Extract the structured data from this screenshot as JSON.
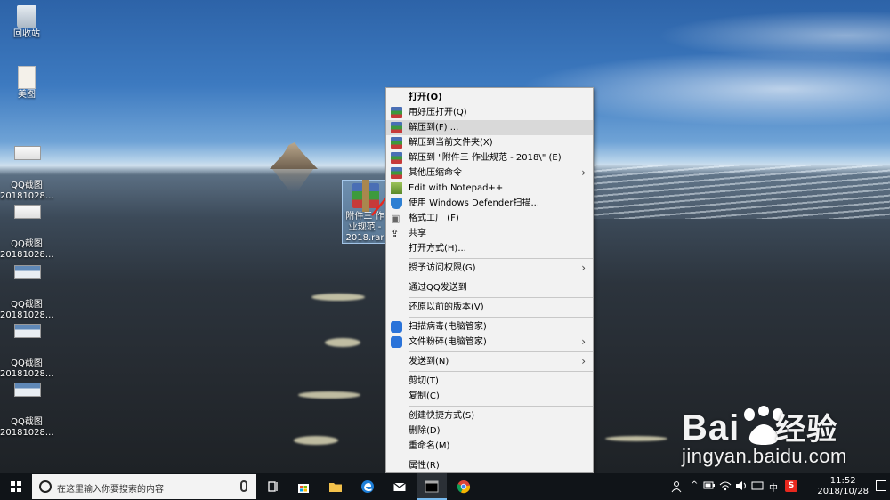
{
  "desktop": {
    "icons": [
      {
        "label": "回收站"
      },
      {
        "label": "美图"
      },
      {
        "label": "QQ截图\n20181028..."
      },
      {
        "label": "QQ截图\n20181028..."
      },
      {
        "label": "QQ截图\n20181028..."
      },
      {
        "label": "QQ截图\n20181028..."
      },
      {
        "label": "QQ截图\n20181028..."
      }
    ],
    "selected_file_label": "附件三 作业规范 - 2018.rar"
  },
  "context_menu": {
    "items": [
      {
        "label": "打开(O)",
        "bold": true
      },
      {
        "label": "用好压打开(Q)",
        "icon": "winrar-icon"
      },
      {
        "label": "解压到(F) ...",
        "icon": "winrar-icon",
        "hover": true
      },
      {
        "label": "解压到当前文件夹(X)",
        "icon": "winrar-icon"
      },
      {
        "label": "解压到 \"附件三  作业规范 - 2018\\\" (E)",
        "icon": "winrar-icon"
      },
      {
        "label": "其他压缩命令",
        "icon": "winrar-icon",
        "submenu": true
      },
      {
        "label": "Edit with Notepad++",
        "icon": "notepad-icon"
      },
      {
        "label": "使用 Windows Defender扫描...",
        "icon": "defender-shield-icon"
      },
      {
        "label": "格式工厂 (F)",
        "icon": "format-factory-icon"
      },
      {
        "label": "共享",
        "icon": "share-icon"
      },
      {
        "label": "打开方式(H)..."
      },
      {
        "label": "授予访问权限(G)",
        "submenu": true,
        "sep_before": true
      },
      {
        "label": "通过QQ发送到",
        "sep_before": true
      },
      {
        "label": "还原以前的版本(V)",
        "sep_before": true
      },
      {
        "label": "扫描病毒(电脑管家)",
        "icon": "qq-pc-manager-icon",
        "sep_before": true
      },
      {
        "label": "文件粉碎(电脑管家)",
        "icon": "qq-pc-manager-icon",
        "submenu": true
      },
      {
        "label": "发送到(N)",
        "submenu": true,
        "sep_before": true
      },
      {
        "label": "剪切(T)",
        "sep_before": true
      },
      {
        "label": "复制(C)"
      },
      {
        "label": "创建快捷方式(S)",
        "sep_before": true
      },
      {
        "label": "删除(D)"
      },
      {
        "label": "重命名(M)"
      },
      {
        "label": "属性(R)",
        "sep_before": true
      }
    ]
  },
  "watermark": {
    "logo_text": "Bai",
    "logo_cn": "经验",
    "url": "jingyan.baidu.com"
  },
  "taskbar": {
    "search_placeholder": "在这里输入你要搜索的内容",
    "ime": "中",
    "time": "11:52",
    "date": "2018/10/28",
    "accent": "#76b9ed"
  }
}
